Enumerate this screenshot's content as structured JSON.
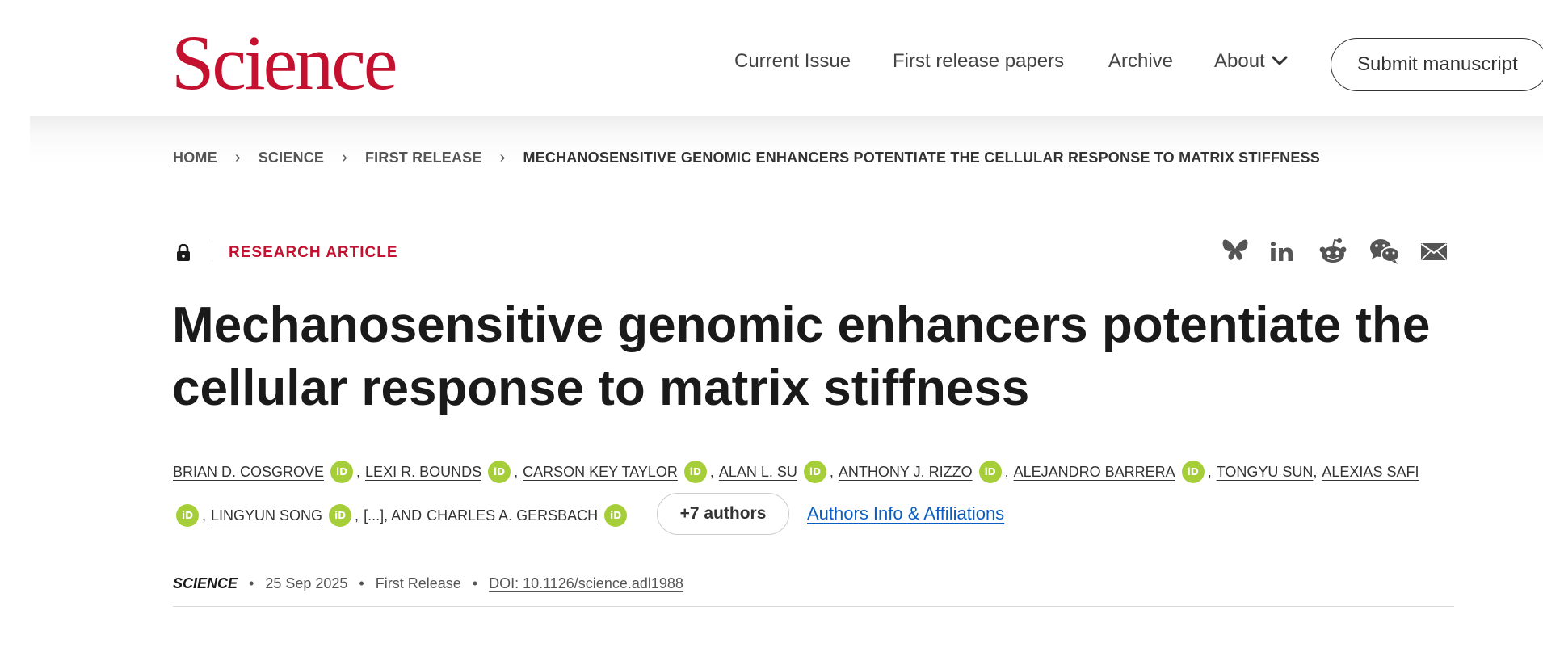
{
  "header": {
    "logo": "Science",
    "nav": {
      "current_issue": "Current Issue",
      "first_release": "First release papers",
      "archive": "Archive",
      "about": "About"
    },
    "submit": "Submit manuscript"
  },
  "breadcrumb": {
    "home": "HOME",
    "science": "SCIENCE",
    "first_release": "FIRST RELEASE",
    "current": "MECHANOSENSITIVE GENOMIC ENHANCERS POTENTIATE THE CELLULAR RESPONSE TO MATRIX STIFFNESS"
  },
  "article": {
    "type": "RESEARCH ARTICLE",
    "title": "Mechanosensitive genomic enhancers potentiate the cellular response to matrix stiffness",
    "authors": [
      "BRIAN D. COSGROVE",
      "LEXI R. BOUNDS",
      "CARSON KEY TAYLOR",
      "ALAN L. SU",
      "ANTHONY J. RIZZO",
      "ALEJANDRO BARRERA",
      "TONGYU SUN",
      "ALEXIAS SAFI",
      "LINGYUN SONG",
      "CHARLES A. GERSBACH"
    ],
    "orcid_label": "iD",
    "ellipsis": "[...]",
    "and": ", AND",
    "more_authors": "+7 authors",
    "affiliations_link": "Authors Info & Affiliations",
    "journal": "SCIENCE",
    "date": "25 Sep 2025",
    "section": "First Release",
    "doi": "DOI: 10.1126/science.adl1988"
  },
  "share_icons": [
    "bluesky-icon",
    "linkedin-icon",
    "reddit-icon",
    "wechat-icon",
    "email-icon"
  ],
  "colors": {
    "brand_red": "#c4112f",
    "orcid_green": "#a6ce39",
    "link_blue": "#0a5ec2"
  }
}
